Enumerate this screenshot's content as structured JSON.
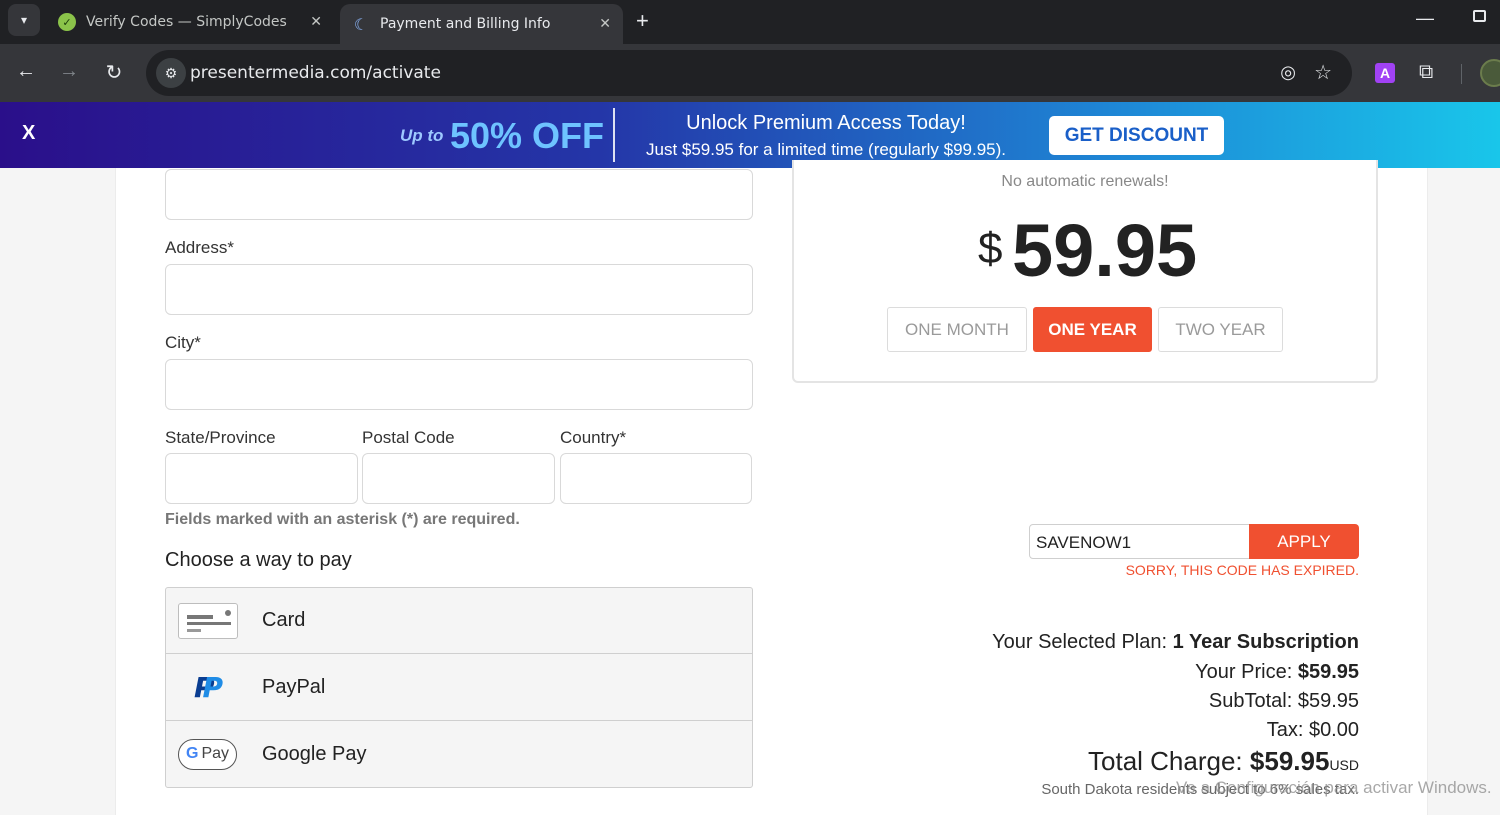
{
  "browser": {
    "tabs": [
      {
        "title": "Verify Codes — SimplyCodes",
        "favicon": "check-icon"
      },
      {
        "title": "Payment and Billing Info",
        "favicon": "presenter-icon",
        "active": true
      }
    ],
    "url": "presentermedia.com/activate"
  },
  "promo": {
    "close": "X",
    "upto": "Up to",
    "discount": "50% OFF",
    "headline": "Unlock Premium Access Today!",
    "subline": "Just $59.95 for a limited time (regularly $99.95).",
    "button": "GET DISCOUNT"
  },
  "form": {
    "address_label": "Address*",
    "city_label": "City*",
    "state_label": "State/Province",
    "postal_label": "Postal Code",
    "country_label": "Country*",
    "required_note": "Fields marked with an asterisk (*) are required.",
    "choose_title": "Choose a way to pay",
    "payment_methods": [
      "Card",
      "PayPal",
      "Google Pay"
    ]
  },
  "plan": {
    "no_renewals": "No automatic renewals!",
    "currency": "$",
    "price": "59.95",
    "options": [
      "ONE MONTH",
      "ONE YEAR",
      "TWO YEAR"
    ],
    "selected": "ONE YEAR"
  },
  "coupon": {
    "code": "SAVENOW1",
    "apply": "APPLY",
    "error": "SORRY, THIS CODE HAS EXPIRED."
  },
  "summary": {
    "plan_label": "Your Selected Plan:",
    "plan_value": "1 Year Subscription",
    "price_label": "Your Price:",
    "price_value": "$59.95",
    "subtotal": "SubTotal: $59.95",
    "tax": "Tax: $0.00",
    "total_label": "Total Charge:",
    "total_value": "$59.95",
    "total_currency": "USD",
    "tax_note": "South Dakota residents subject to 6% sales tax."
  },
  "watermark": "Ve a Configuración para activar Windows."
}
